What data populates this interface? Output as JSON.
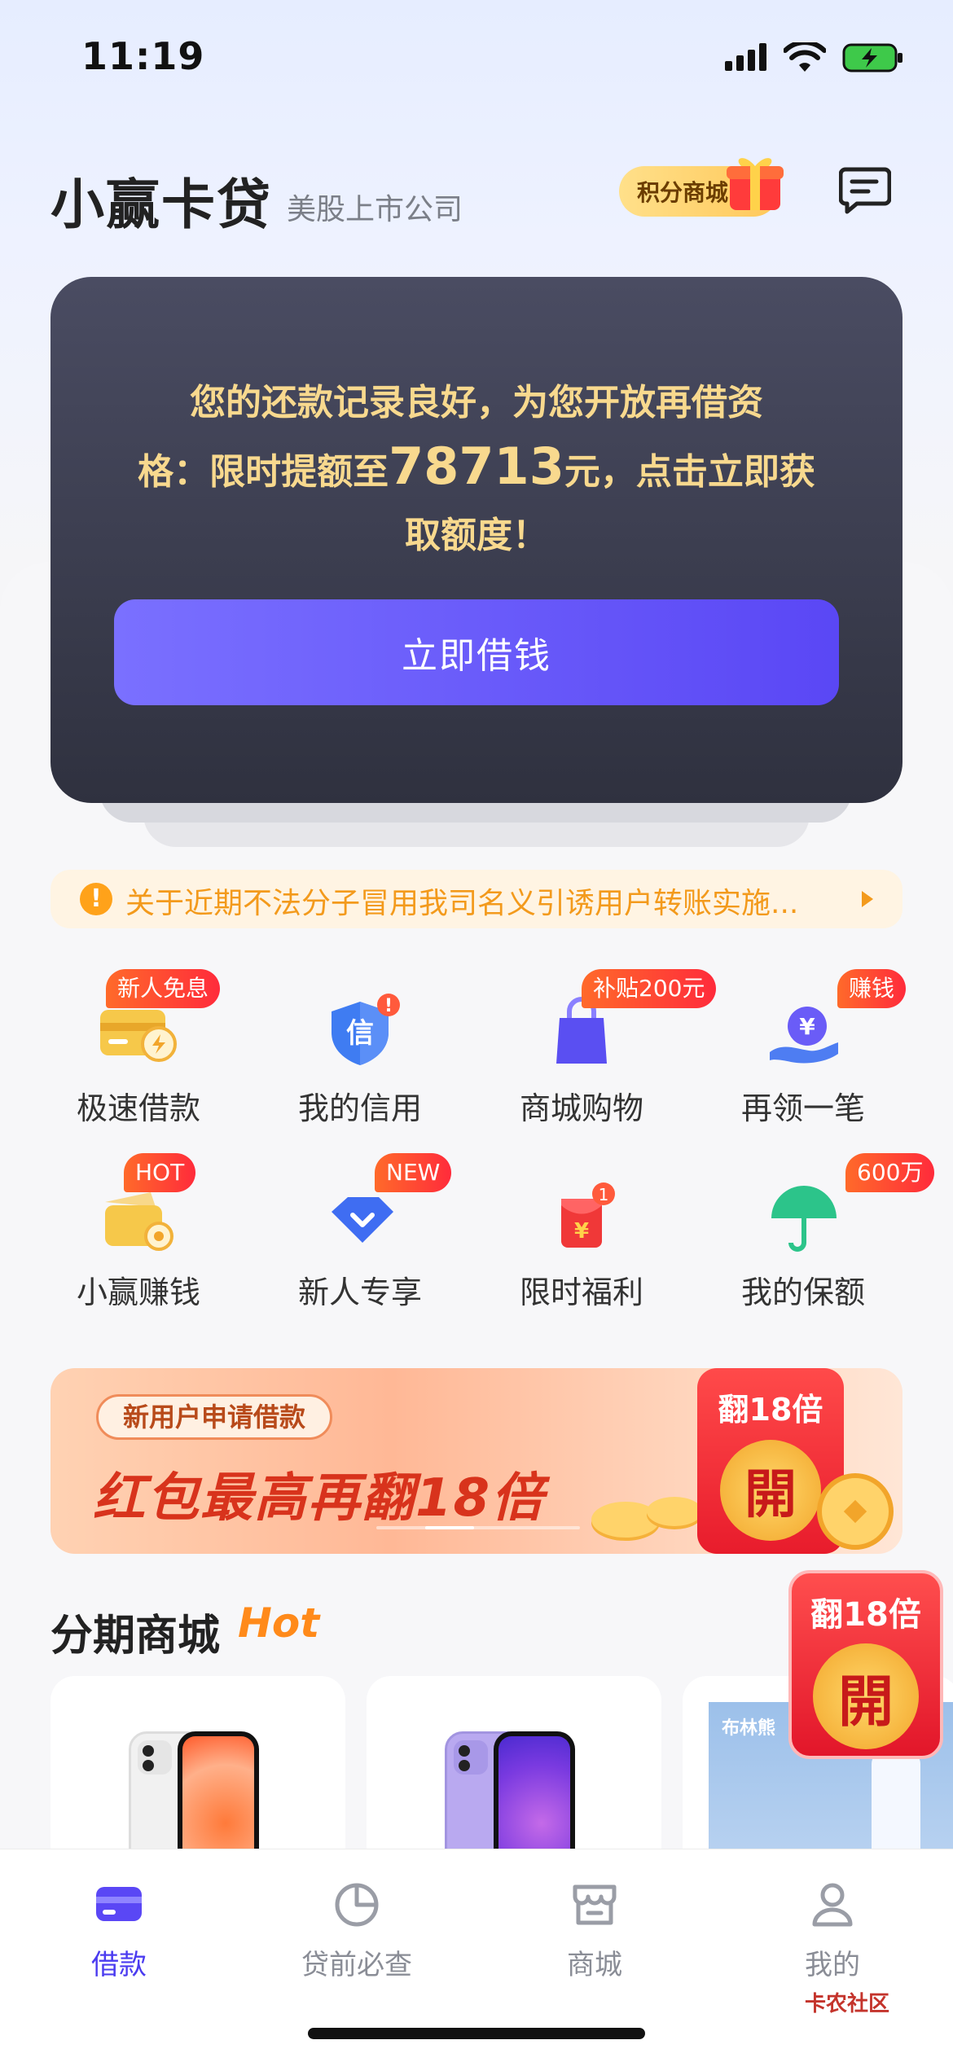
{
  "status_bar": {
    "time": "11:19"
  },
  "header": {
    "brand": "小赢卡贷",
    "subtitle": "美股上市公司",
    "points_mall": "积分商城"
  },
  "promo_card": {
    "line1": "您的还款记录良好，为您开放再借资",
    "line2_prefix": "格：限时提额至",
    "amount": "78713",
    "line2_suffix": "元，点击立即获",
    "line3": "取额度！",
    "button": "立即借钱"
  },
  "notice": {
    "text": "关于近期不法分子冒用我司名义引诱用户转账实施..."
  },
  "grid": [
    {
      "label": "极速借款",
      "badge": "新人免息",
      "icon": "card-lightning-icon"
    },
    {
      "label": "我的信用",
      "badge": "!",
      "icon": "credit-shield-icon"
    },
    {
      "label": "商城购物",
      "badge": "补贴200元",
      "icon": "shopping-bag-icon"
    },
    {
      "label": "再领一笔",
      "badge": "赚钱",
      "icon": "yuan-hand-icon"
    },
    {
      "label": "小赢赚钱",
      "badge": "HOT",
      "icon": "wallet-coin-icon"
    },
    {
      "label": "新人专享",
      "badge": "NEW",
      "icon": "diamond-icon"
    },
    {
      "label": "限时福利",
      "badge": "1",
      "icon": "red-packet-icon"
    },
    {
      "label": "我的保额",
      "badge": "600万",
      "icon": "umbrella-icon"
    }
  ],
  "banner": {
    "tag": "新用户申请借款",
    "headline": "红包最高再翻18倍",
    "envelope_title": "翻18倍",
    "envelope_char": "開"
  },
  "floating_packet": {
    "title": "翻18倍",
    "char": "開"
  },
  "mall": {
    "title": "分期商城",
    "hot": "Hot",
    "product3_brand": "布林熊"
  },
  "tabs": [
    {
      "label": "借款",
      "icon": "card-icon",
      "active": true
    },
    {
      "label": "贷前必查",
      "icon": "pie-chart-icon",
      "active": false
    },
    {
      "label": "商城",
      "icon": "store-icon",
      "active": false
    },
    {
      "label": "我的",
      "icon": "user-icon",
      "active": false
    }
  ],
  "watermark": "卡农社区",
  "colors": {
    "accent": "#5a47f5",
    "gold_text": "#f8d98e",
    "warning": "#f39a1c",
    "badge_red": "#ff2b3b"
  }
}
